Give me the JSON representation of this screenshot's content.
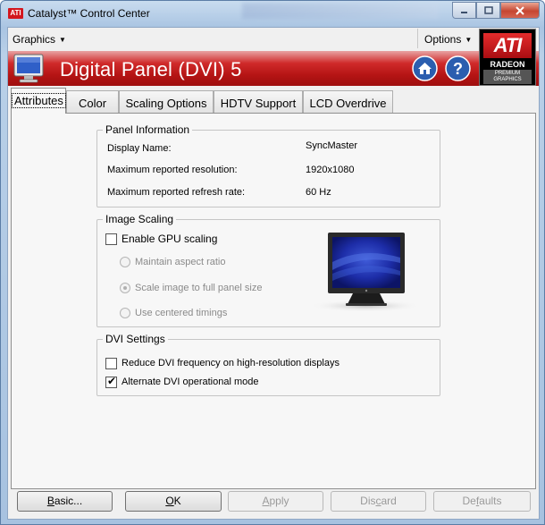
{
  "window": {
    "title": "Catalyst™ Control Center",
    "logo_text": "ATI"
  },
  "menu": {
    "graphics": "Graphics",
    "options": "Options"
  },
  "badge": {
    "logo": "ATI",
    "radeon": "RADEON",
    "premium_line1": "PREMIUM",
    "premium_line2": "GRAPHICS"
  },
  "header": {
    "title": "Digital Panel (DVI) 5",
    "home_icon": "home-icon",
    "help_icon": "help-icon"
  },
  "tabs": [
    {
      "label": "Attributes",
      "active": true
    },
    {
      "label": "Color"
    },
    {
      "label": "Scaling Options"
    },
    {
      "label": "HDTV Support"
    },
    {
      "label": "LCD Overdrive"
    }
  ],
  "panel_info": {
    "title": "Panel Information",
    "rows": [
      {
        "label": "Display Name:",
        "value": "SyncMaster"
      },
      {
        "label": "Maximum reported resolution:",
        "value": "1920x1080"
      },
      {
        "label": "Maximum reported refresh rate:",
        "value": "60 Hz"
      }
    ]
  },
  "image_scaling": {
    "title": "Image Scaling",
    "enable_gpu_scaling": {
      "label": "Enable GPU scaling",
      "checked": false
    },
    "options": [
      {
        "label": "Maintain aspect ratio",
        "selected": false
      },
      {
        "label": "Scale image to full panel size",
        "selected": true
      },
      {
        "label": "Use centered timings",
        "selected": false
      }
    ]
  },
  "dvi_settings": {
    "title": "DVI Settings",
    "reduce_freq": {
      "label": "Reduce DVI frequency on high-resolution displays",
      "checked": false
    },
    "alternate_mode": {
      "label": "Alternate DVI operational mode",
      "checked": true
    }
  },
  "buttons": {
    "basic": {
      "pre": "",
      "ul": "B",
      "post": "asic..."
    },
    "ok": {
      "pre": "",
      "ul": "O",
      "post": "K"
    },
    "apply": {
      "pre": "",
      "ul": "A",
      "post": "pply"
    },
    "discard": {
      "pre": "Dis",
      "ul": "c",
      "post": "ard"
    },
    "defaults": {
      "pre": "De",
      "ul": "f",
      "post": "aults"
    }
  },
  "colors": {
    "header_red": "#b41414",
    "ati_red": "#d3161d"
  }
}
